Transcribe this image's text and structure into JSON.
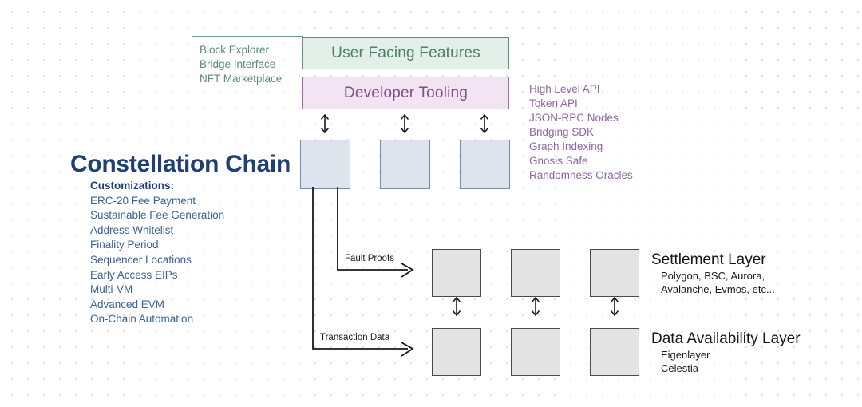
{
  "diagram": {
    "title": "Constellation Chain",
    "header_boxes": {
      "user_facing": "User Facing Features",
      "developer_tooling": "Developer Tooling"
    },
    "user_facing_list": [
      "Block Explorer",
      "Bridge Interface",
      "NFT Marketplace"
    ],
    "developer_tooling_list": [
      "High Level API",
      "Token API",
      "JSON-RPC Nodes",
      "Bridging SDK",
      "Graph Indexing",
      "Gnosis Safe",
      "Randomness Oracles"
    ],
    "customizations": {
      "heading": "Customizations:",
      "items": [
        "ERC-20 Fee Payment",
        "Sustainable Fee Generation",
        "Address Whitelist",
        "Finality Period",
        "Sequencer Locations",
        "Early Access EIPs",
        "Multi-VM",
        "Advanced EVM",
        "On-Chain Automation"
      ]
    },
    "connector_labels": {
      "fault_proofs": "Fault Proofs",
      "transaction_data": "Transaction Data"
    },
    "settlement_layer": {
      "title": "Settlement Layer",
      "line1": "Polygon, BSC, Aurora,",
      "line2": "Avalanche, Evmos, etc..."
    },
    "data_availability_layer": {
      "title": "Data Availability Layer",
      "line1": "Eigenlayer",
      "line2": "Celestia"
    },
    "colors": {
      "green_fill": "#e3efe9",
      "green_stroke": "#5f8f7c",
      "green_text": "#4b7f6b",
      "purple_fill": "#f2e4f2",
      "purple_stroke": "#9a6c9c",
      "purple_text": "#7b4f84",
      "blue_box_fill": "#dde4ee",
      "blue_box_stroke": "#7b8aa8",
      "gray_box_fill": "#e4e4e4",
      "gray_box_stroke": "#4a4a4a",
      "title_navy": "#1f3f75",
      "background": "#ffffff"
    }
  }
}
